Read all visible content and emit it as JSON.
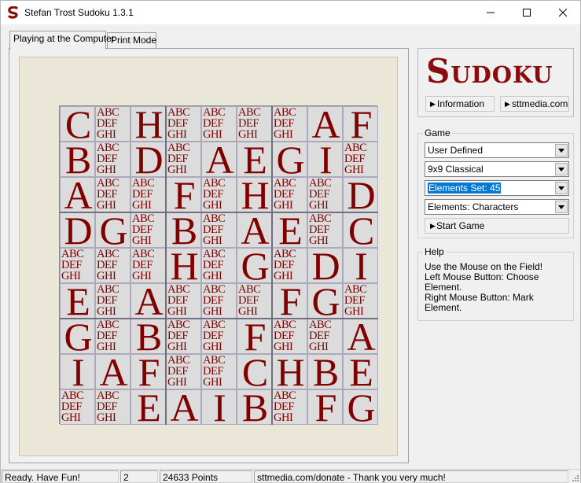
{
  "window": {
    "title": "Stefan Trost Sudoku 1.3.1",
    "icon": "sudoku-s-icon",
    "controls": [
      "minimize-icon",
      "maximize-icon",
      "close-icon"
    ]
  },
  "tabs": [
    {
      "label": "Playing at the Computer",
      "active": true
    },
    {
      "label": "Print Mode",
      "active": false
    }
  ],
  "board": {
    "size": 9,
    "candidates": "ABC\nDEF\nGHI",
    "grid": [
      [
        "C",
        "",
        "H",
        "",
        "",
        "",
        "",
        "A",
        "F"
      ],
      [
        "B",
        "",
        "D",
        "",
        "A",
        "E",
        "G",
        "I",
        ""
      ],
      [
        "A",
        "",
        "",
        "F",
        "",
        "H",
        "",
        "",
        "D"
      ],
      [
        "D",
        "G",
        "",
        "B",
        "",
        "A",
        "E",
        "",
        "C"
      ],
      [
        "",
        "",
        "",
        "H",
        "",
        "G",
        "",
        "D",
        "I"
      ],
      [
        "E",
        "",
        "A",
        "",
        "",
        "",
        "F",
        "G",
        ""
      ],
      [
        "G",
        "",
        "B",
        "",
        "",
        "F",
        "",
        "",
        "A"
      ],
      [
        "I",
        "A",
        "F",
        "",
        "",
        "C",
        "H",
        "B",
        "E"
      ],
      [
        "",
        "",
        "E",
        "A",
        "I",
        "B",
        "",
        "F",
        "G"
      ]
    ],
    "colors": {
      "letter": "#800000",
      "cell_bg": "#dcdcdc",
      "board_bg": "#eae6d8"
    }
  },
  "logo": {
    "text": "Sudoku",
    "color": "#8a0c0c"
  },
  "links": {
    "information": "Information",
    "website": "sttmedia.com"
  },
  "game": {
    "label": "Game",
    "mode": "User Defined",
    "type": "9x9 Classical",
    "elements_set": "Elements Set: 45",
    "elements": "Elements: Characters",
    "start_label": "Start Game"
  },
  "help": {
    "label": "Help",
    "lines": [
      "Use the Mouse on the Field!",
      "Left Mouse Button: Choose Element.",
      "Right Mouse Button: Mark Element."
    ]
  },
  "status": {
    "message": "Ready. Have Fun!",
    "count": "2",
    "points": "24633 Points",
    "donate": "sttmedia.com/donate - Thank you very much!"
  },
  "colors": {
    "accent": "#0078d7",
    "brand": "#8a0c0c"
  }
}
